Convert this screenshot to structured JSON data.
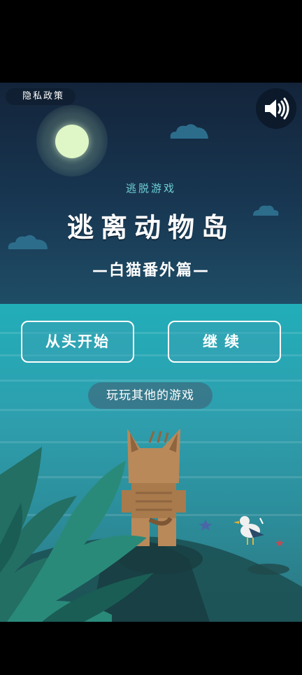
{
  "top_bar": {
    "privacy_label": "隐私政策"
  },
  "sound": {
    "icon": "speaker-icon",
    "state": "on"
  },
  "header": {
    "subtitle": "逃脱游戏",
    "title": "逃离动物岛",
    "subtitle2": "—白猫番外篇—"
  },
  "buttons": {
    "start_label": "从头开始",
    "continue_label": "继续",
    "more_games_label": "玩玩其他的游戏"
  },
  "colors": {
    "sky": "#13243a",
    "sea": "#21aeb9",
    "cat": "#b9895a",
    "moon": "#dff6c6"
  }
}
